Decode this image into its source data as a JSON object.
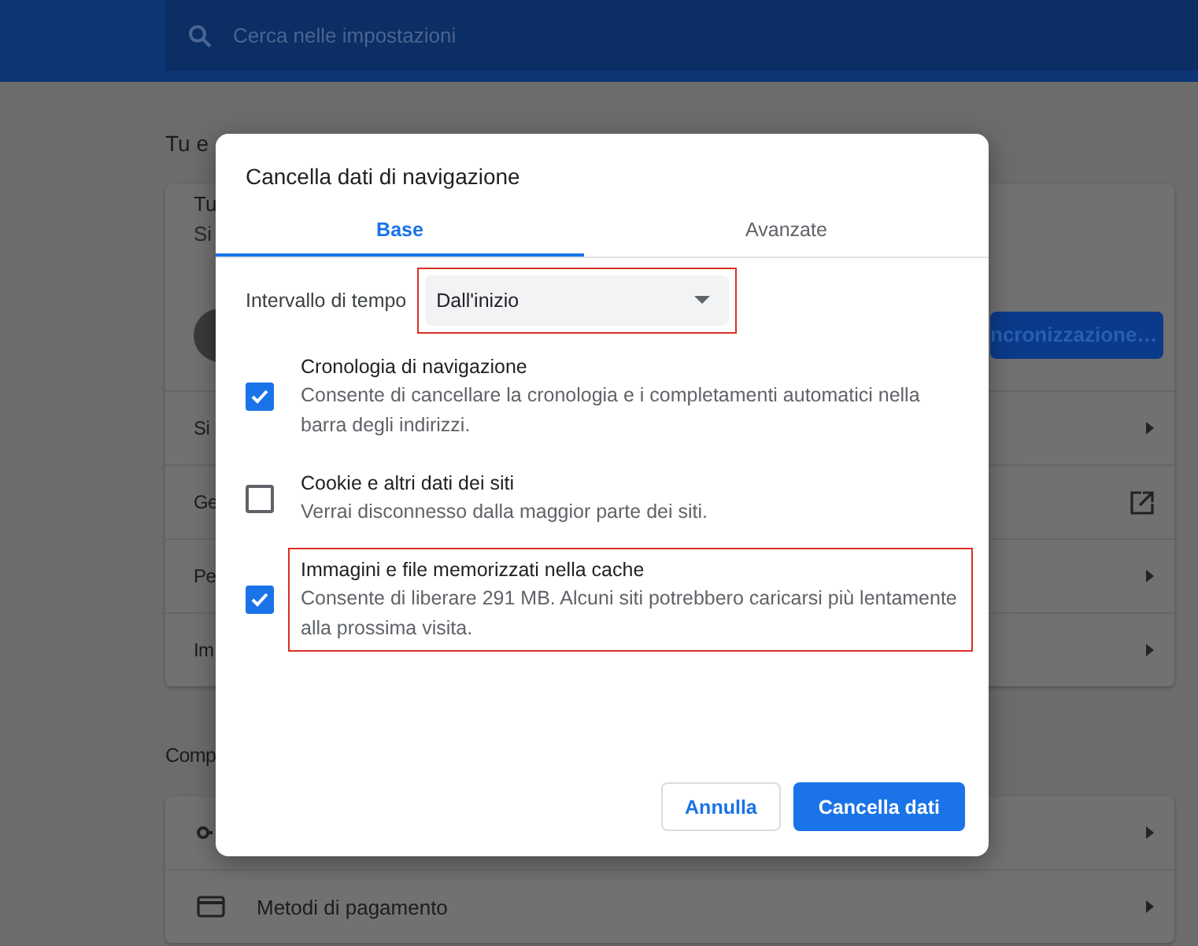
{
  "search": {
    "placeholder": "Cerca nelle impostazioni"
  },
  "background": {
    "section_1": "Tu e",
    "card_1": {
      "header_lines": [
        "Tu",
        "Si"
      ],
      "sync_button": "ncronizzazione…",
      "rows": [
        {
          "label": "Si",
          "kind": "arrow"
        },
        {
          "label": "Ge",
          "kind": "external"
        },
        {
          "label": "Pe",
          "kind": "arrow"
        },
        {
          "label": "Im",
          "kind": "arrow"
        }
      ]
    },
    "section_2": "Comp",
    "card_2": {
      "rows": [
        {
          "kind": "key"
        },
        {
          "kind": "card",
          "label": "Metodi di pagamento"
        }
      ]
    }
  },
  "dialog": {
    "title": "Cancella dati di navigazione",
    "tabs": [
      {
        "label": "Base",
        "selected": true
      },
      {
        "label": "Avanzate",
        "selected": false
      }
    ],
    "time_range": {
      "label": "Intervallo di tempo",
      "value": "Dall'inizio",
      "highlighted": true
    },
    "options": [
      {
        "title": "Cronologia di navigazione",
        "description": "Consente di cancellare la cronologia e i completamenti automatici nella barra degli indirizzi.",
        "checked": true,
        "highlighted": false
      },
      {
        "title": "Cookie e altri dati dei siti",
        "description": "Verrai disconnesso dalla maggior parte dei siti.",
        "checked": false,
        "highlighted": false
      },
      {
        "title": "Immagini e file memorizzati nella cache",
        "description": "Consente di liberare 291 MB. Alcuni siti potrebbero caricarsi più lentamente alla prossima visita.",
        "checked": true,
        "highlighted": true
      }
    ],
    "buttons": [
      {
        "label": "Annulla",
        "kind": "secondary"
      },
      {
        "label": "Cancella dati",
        "kind": "primary"
      }
    ]
  }
}
